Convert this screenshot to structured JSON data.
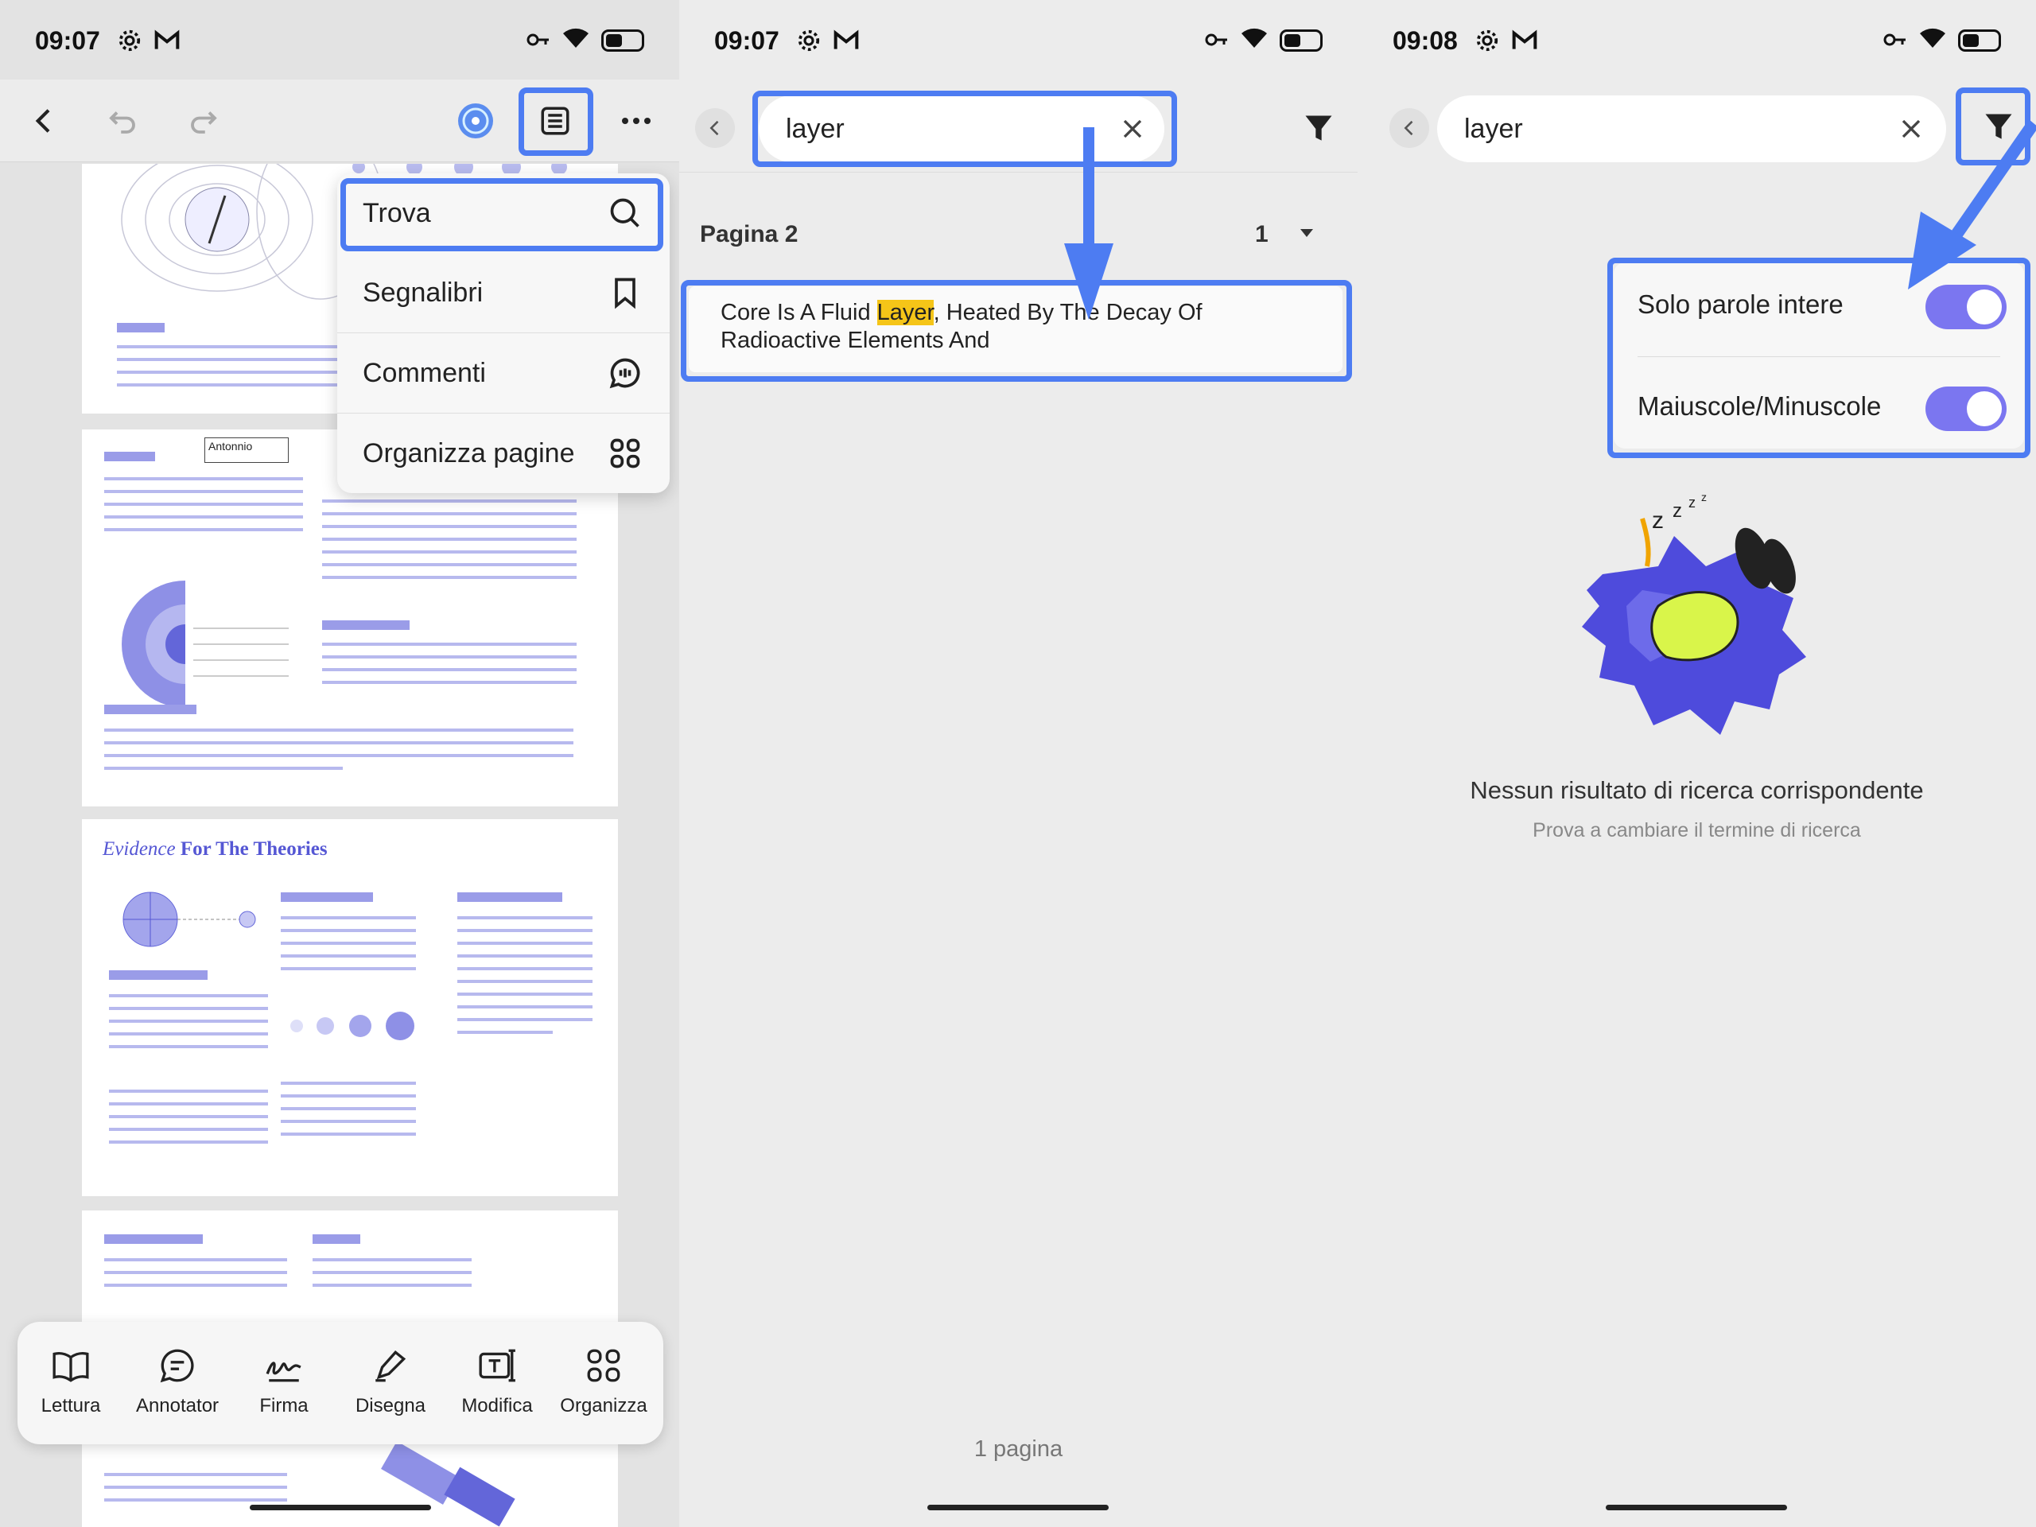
{
  "panel1": {
    "status": {
      "time": "09:07"
    },
    "annotation": {
      "text": "Antonnio"
    },
    "menu": {
      "items": [
        {
          "label": "Trova",
          "icon": "search-icon"
        },
        {
          "label": "Segnalibri",
          "icon": "bookmark-icon"
        },
        {
          "label": "Commenti",
          "icon": "comment-icon"
        },
        {
          "label": "Organizza pagine",
          "icon": "grid-icon"
        }
      ]
    },
    "pages": {
      "evidence_title_italic": "Evidence",
      "evidence_title_rest": "For The Theories"
    },
    "bottom_bar": [
      {
        "label": "Lettura",
        "icon": "book-icon"
      },
      {
        "label": "Annotator",
        "icon": "annotate-icon"
      },
      {
        "label": "Firma",
        "icon": "signature-icon"
      },
      {
        "label": "Disegna",
        "icon": "draw-icon"
      },
      {
        "label": "Modifica",
        "icon": "edit-text-icon"
      },
      {
        "label": "Organizza",
        "icon": "grid-icon"
      }
    ]
  },
  "panel2": {
    "status": {
      "time": "09:07"
    },
    "search": {
      "value": "layer"
    },
    "result_group": {
      "page_label": "Pagina 2",
      "count": "1"
    },
    "result": {
      "before": "Core Is A Fluid ",
      "match": "Layer",
      "after": ", Heated By The Decay Of Radioactive Elements And"
    },
    "footer": "1 pagina"
  },
  "panel3": {
    "status": {
      "time": "09:08"
    },
    "search": {
      "value": "layer"
    },
    "filters": [
      {
        "label": "Solo parole intere",
        "on": true
      },
      {
        "label": "Maiuscole/Minuscole",
        "on": true
      }
    ],
    "empty_title": "Nessun risultato di ricerca corrispondente",
    "empty_subtitle": "Prova a cambiare il termine di ricerca"
  },
  "colors": {
    "accent": "#4d7cf2",
    "toggle": "#7b76f0",
    "highlight": "#f5c518",
    "document_purple": "#6366d9"
  }
}
